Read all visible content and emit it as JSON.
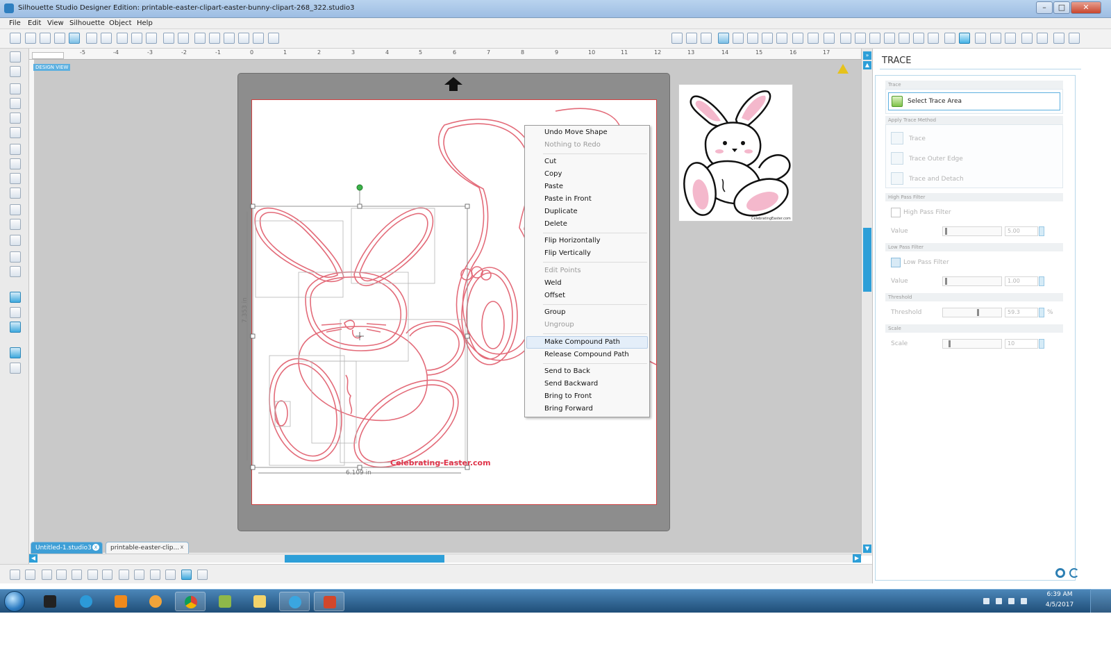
{
  "window": {
    "title": "Silhouette Studio Designer Edition: printable-easter-clipart-easter-bunny-clipart-268_322.studio3",
    "minimize": "–",
    "maximize": "□",
    "close": "✕"
  },
  "menu": [
    "File",
    "Edit",
    "View",
    "Silhouette",
    "Object",
    "Help"
  ],
  "toolbar": {
    "icons": [
      "new-file-icon",
      "open-icon",
      "save-icon",
      "save-as-icon",
      "print-icon",
      "cut-settings-icon",
      "copy-icon",
      "paste-icon",
      "cut-icon",
      "undo-icon",
      "redo-icon",
      "pan-icon",
      "zoom-in-icon",
      "zoom-out-icon",
      "zoom-select-icon",
      "drag-zoom-icon",
      "fit-page-icon"
    ],
    "right_icons": [
      "registration-icon",
      "grid-icon",
      "page-setup-icon",
      "fill-color-icon",
      "line-color-icon",
      "line-style-icon",
      "fill-pattern-icon",
      "shadow-icon",
      "offset-icon",
      "text-style-icon",
      "align-icon",
      "replicate-icon",
      "modify-icon",
      "knife-icon",
      "transform-icon",
      "point-edit-icon",
      "trace-icon",
      "library-icon",
      "store-icon",
      "send-to-silhouette-icon",
      "cut-settings-panel-icon",
      "settings-gear-icon",
      "preferences-icon",
      "sketch-icon",
      "layers-icon"
    ]
  },
  "ruler": {
    "readout": "",
    "design_view": "DESIGN VIEW",
    "numbers": [
      "-5",
      "-4",
      "-3",
      "-2",
      "-1",
      "0",
      "1",
      "2",
      "3",
      "4",
      "5",
      "6",
      "7",
      "8",
      "9",
      "10",
      "11",
      "12",
      "13",
      "14",
      "15",
      "16",
      "17"
    ]
  },
  "canvas": {
    "width_label": "6.109 in",
    "height_label": "7.353 in",
    "watermark": "Celebrating-Easter.com",
    "thumbnail_credit": "CelebratingEaster.com"
  },
  "context_menu": {
    "items": [
      {
        "label": "Undo Move Shape",
        "enabled": true
      },
      {
        "label": "Nothing to Redo",
        "enabled": false
      },
      {
        "label": "Cut",
        "enabled": true
      },
      {
        "label": "Copy",
        "enabled": true
      },
      {
        "label": "Paste",
        "enabled": true
      },
      {
        "label": "Paste in Front",
        "enabled": true
      },
      {
        "label": "Duplicate",
        "enabled": true
      },
      {
        "label": "Delete",
        "enabled": true
      },
      {
        "label": "Flip Horizontally",
        "enabled": true
      },
      {
        "label": "Flip Vertically",
        "enabled": true
      },
      {
        "label": "Edit Points",
        "enabled": false
      },
      {
        "label": "Weld",
        "enabled": true
      },
      {
        "label": "Offset",
        "enabled": true
      },
      {
        "label": "Group",
        "enabled": true
      },
      {
        "label": "Ungroup",
        "enabled": false
      },
      {
        "label": "Make Compound Path",
        "enabled": true,
        "highlighted": true
      },
      {
        "label": "Release Compound Path",
        "enabled": true
      },
      {
        "label": "Send to Back",
        "enabled": true
      },
      {
        "label": "Send Backward",
        "enabled": true
      },
      {
        "label": "Bring to Front",
        "enabled": true
      },
      {
        "label": "Bring Forward",
        "enabled": true
      }
    ]
  },
  "trace_panel": {
    "title": "TRACE",
    "section_trace": "Trace",
    "select_trace_area": "Select Trace Area",
    "section_apply": "Apply Trace Method",
    "method_trace": "Trace",
    "method_outer_edge": "Trace Outer Edge",
    "method_detach": "Trace and Detach",
    "section_high_pass": "High Pass Filter",
    "high_pass_label": "High Pass Filter",
    "high_pass_checked": false,
    "high_pass_value_label": "Value",
    "high_pass_value": "5.00",
    "section_low_pass": "Low Pass Filter",
    "low_pass_label": "Low Pass Filter",
    "low_pass_checked": true,
    "low_pass_value_label": "Value",
    "low_pass_value": "1.00",
    "section_threshold": "Threshold",
    "threshold_label": "Threshold",
    "threshold_value": "59.3",
    "threshold_unit": "%",
    "section_scale": "Scale",
    "scale_label": "Scale",
    "scale_value": "10"
  },
  "tabs": [
    {
      "label": "Untitled-1.studio3",
      "active": true,
      "close": "x"
    },
    {
      "label": "printable-easter-clip...",
      "active": false,
      "close": "x"
    }
  ],
  "taskbar": {
    "apps": [
      "windows-media-icon",
      "internet-explorer-icon",
      "vlc-icon",
      "media-player-icon",
      "chrome-icon",
      "app-x-icon",
      "file-explorer-icon",
      "silhouette-studio-icon",
      "powerpoint-icon"
    ],
    "time": "6:39 AM",
    "date": "4/5/2017"
  },
  "colors": {
    "accent": "#2d9fd8",
    "cut_line": "#e36b79",
    "watermark": "#e0344a",
    "mat": "#8d8d8d"
  }
}
